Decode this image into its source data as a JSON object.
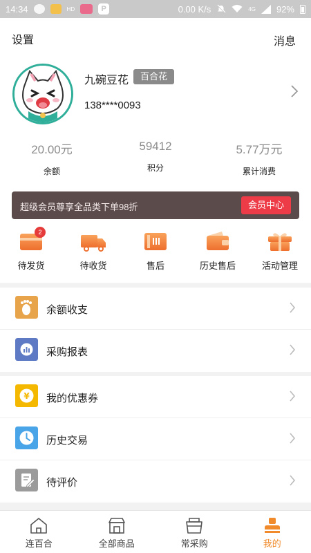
{
  "status_bar": {
    "time": "14:34",
    "net_speed": "0.00 K/s",
    "signal_label": "4G",
    "battery": "92%",
    "hd_label": "HD",
    "p_label": "P"
  },
  "header": {
    "settings_label": "设置",
    "messages_label": "消息"
  },
  "user": {
    "name": "九碗豆花",
    "badge": "百合花",
    "phone": "138****0093"
  },
  "stats": [
    {
      "value": "20.00元",
      "label": "余额"
    },
    {
      "value": "59412",
      "label": "积分"
    },
    {
      "value": "5.77万元",
      "label": "累计消费"
    }
  ],
  "vip": {
    "text": "超级会员尊享全品类下单98折",
    "button": "会员中心"
  },
  "orders": [
    {
      "label": "待发货",
      "icon": "box-card-icon",
      "badge": "2"
    },
    {
      "label": "待收货",
      "icon": "truck-icon"
    },
    {
      "label": "售后",
      "icon": "return-card-icon"
    },
    {
      "label": "历史售后",
      "icon": "wallet-icon"
    },
    {
      "label": "活动管理",
      "icon": "gift-icon"
    }
  ],
  "menu_group_1": [
    {
      "label": "余额收支",
      "icon": "footprint-icon",
      "color": "#e7a44b"
    },
    {
      "label": "采购报表",
      "icon": "report-chart-icon",
      "color": "#5e7ac4"
    }
  ],
  "menu_group_2": [
    {
      "label": "我的优惠券",
      "icon": "yen-coupon-icon",
      "color": "#f5b800"
    },
    {
      "label": "历史交易",
      "icon": "clock-icon",
      "color": "#4aa4e8"
    },
    {
      "label": "待评价",
      "icon": "edit-note-icon",
      "color": "#9b9b9b"
    }
  ],
  "tabs": [
    {
      "label": "连百合",
      "icon": "home-icon"
    },
    {
      "label": "全部商品",
      "icon": "store-icon"
    },
    {
      "label": "常采购",
      "icon": "basket-icon"
    },
    {
      "label": "我的",
      "icon": "user-icon",
      "active": true
    }
  ],
  "colors": {
    "accent": "#f08a2a",
    "vip_bar": "#5b4b4b",
    "vip_button": "#ed3b48",
    "avatar_ring": "#2fae9a"
  }
}
